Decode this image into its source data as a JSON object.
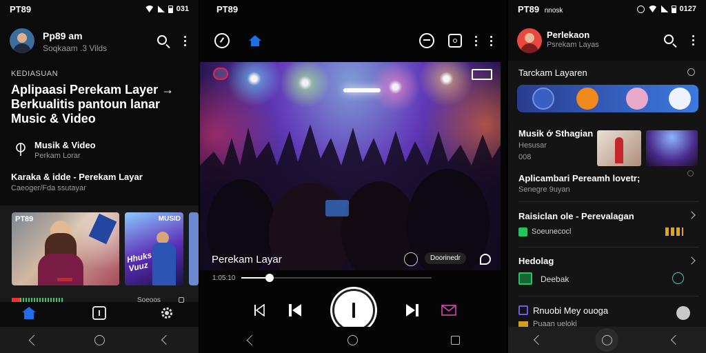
{
  "screen1": {
    "status": {
      "time": "PT89",
      "battery": "031"
    },
    "profile": {
      "name": "Pp89 am",
      "subtitle": "Soqkaam .3 Vilds"
    },
    "hero": {
      "kicker": "KEDIASUAN",
      "title": "Aplipaasi Perekam Layer → Berkualitis pantoun lanar Music & Video"
    },
    "item1": {
      "title": "Musik & Video",
      "subtitle": "Perkam Lorar"
    },
    "item2": {
      "title": "Karaka & idde - Perekam Layar",
      "subtitle": "Caeoger/Fda ssutayar"
    },
    "card1": {
      "label": "PT89"
    },
    "card2": {
      "label": "MUSID",
      "art_text": "Hhuks Vuuz"
    },
    "footer": {
      "caption": "Soeoos"
    }
  },
  "screen2": {
    "status": {
      "time": "PT89"
    },
    "video": {
      "title": "Perekam Layar",
      "time": "1:05:10",
      "chip": "Doorinedr",
      "progress": 0.15
    }
  },
  "screen3": {
    "status": {
      "time": "PT89",
      "extra": "nnosk",
      "battery": "0127"
    },
    "profile": {
      "name": "Perlekaon",
      "subtitle": "Psrekam Layas"
    },
    "section_title": "Tarckam Layaren",
    "list": [
      {
        "title": "Musik ớ Sthagian",
        "line2": "Hesusar",
        "line3": "008"
      },
      {
        "title": "Aplicambari Pereamh lovetr;",
        "line2": "Senegre 9uyan"
      },
      {
        "title": "Raisiclan ole - Perevalagan",
        "line2": "Soeunecocl"
      },
      {
        "title": "Hedolag",
        "line2": "Deebak"
      },
      {
        "title": "Rnuobi Mey ouoga",
        "line2": "Puaan ueloki"
      }
    ]
  },
  "colors": {
    "accent_blue": "#1e6fe6",
    "card_red": "#c4262b",
    "play_white": "#ffffff",
    "mail_pink": "#d946b8",
    "check_green": "#22c55e",
    "stage_purple": "#5b2bb5"
  }
}
